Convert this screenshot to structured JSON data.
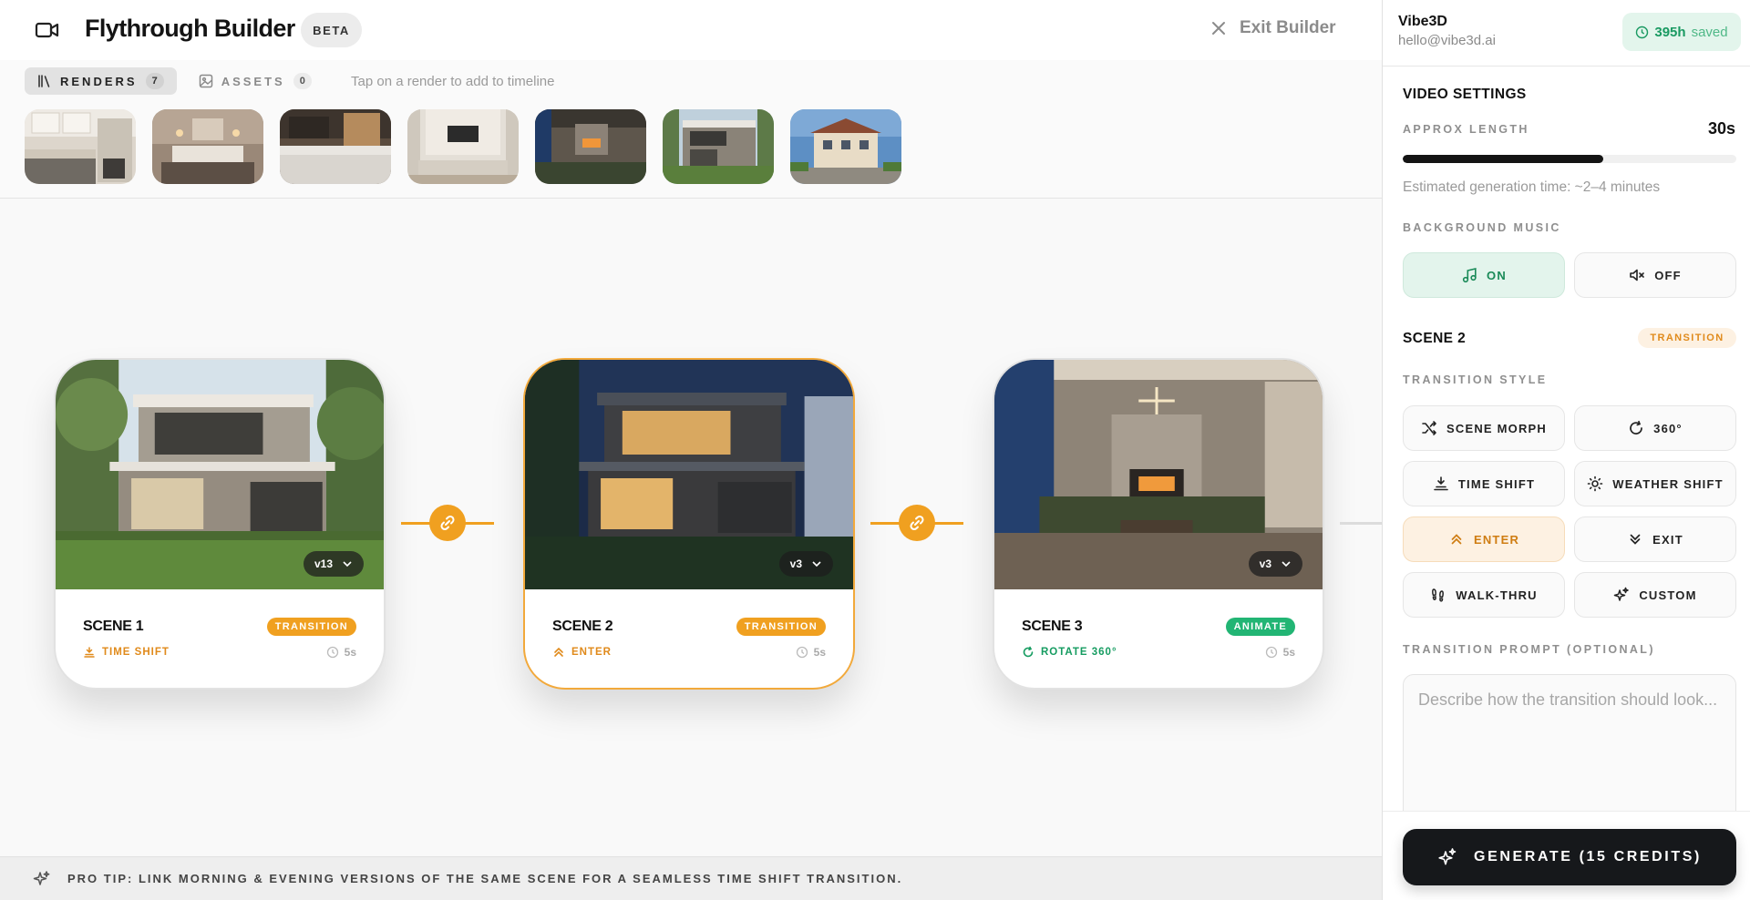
{
  "header": {
    "title": "Flythrough Builder",
    "badge": "BETA",
    "exit_label": "Exit Builder"
  },
  "library": {
    "tabs": [
      {
        "label": "RENDERS",
        "count": "7",
        "icon": "library-icon"
      },
      {
        "label": "ASSETS",
        "count": "0",
        "icon": "image-icon"
      }
    ],
    "hint": "Tap on a render to add to timeline",
    "thumbnails": [
      "kitchen-render",
      "bedroom-render",
      "kitchen-island-render",
      "living-room-tv-render",
      "living-fireplace-render",
      "modern-house-render",
      "villa-render"
    ]
  },
  "scenes": [
    {
      "name": "SCENE 1",
      "badge": "TRANSITION",
      "badge_color": "#f0a020",
      "effect": "TIME SHIFT",
      "effect_color": "#e08a1b",
      "duration": "5s",
      "version": "v13"
    },
    {
      "name": "SCENE 2",
      "badge": "TRANSITION",
      "badge_color": "#f0a020",
      "effect": "ENTER",
      "effect_color": "#e08a1b",
      "duration": "5s",
      "version": "v3"
    },
    {
      "name": "SCENE 3",
      "badge": "ANIMATE",
      "badge_color": "#22b574",
      "effect": "ROTATE 360°",
      "effect_color": "#169c61",
      "duration": "5s",
      "version": "v3"
    }
  ],
  "tip": "PRO TIP: LINK MORNING & EVENING VERSIONS OF THE SAME SCENE FOR A SEAMLESS TIME SHIFT TRANSITION.",
  "user": {
    "name": "Vibe3D",
    "email": "hello@vibe3d.ai",
    "saved_value": "395h",
    "saved_label": "saved"
  },
  "settings": {
    "title": "VIDEO SETTINGS",
    "length_label": "APPROX LENGTH",
    "length_value": "30s",
    "length_fraction": 0.6,
    "estimate": "Estimated generation time: ~2–4 minutes",
    "music_label": "BACKGROUND MUSIC",
    "music_on": "ON",
    "music_off": "OFF",
    "music_selected": "ON"
  },
  "scene_panel": {
    "title": "SCENE 2",
    "badge": "TRANSITION",
    "style_label": "TRANSITION STYLE",
    "styles": [
      "SCENE MORPH",
      "360°",
      "TIME SHIFT",
      "WEATHER SHIFT",
      "ENTER",
      "EXIT",
      "WALK-THRU",
      "CUSTOM"
    ],
    "selected_style": "ENTER",
    "prompt_label": "TRANSITION PROMPT (OPTIONAL)",
    "prompt_placeholder": "Describe how the transition should look...",
    "prompt_value": ""
  },
  "generate_label": "GENERATE (15 CREDITS)",
  "colors": {
    "accent": "#f0a020",
    "success": "#22b574",
    "dark": "#16181b"
  }
}
